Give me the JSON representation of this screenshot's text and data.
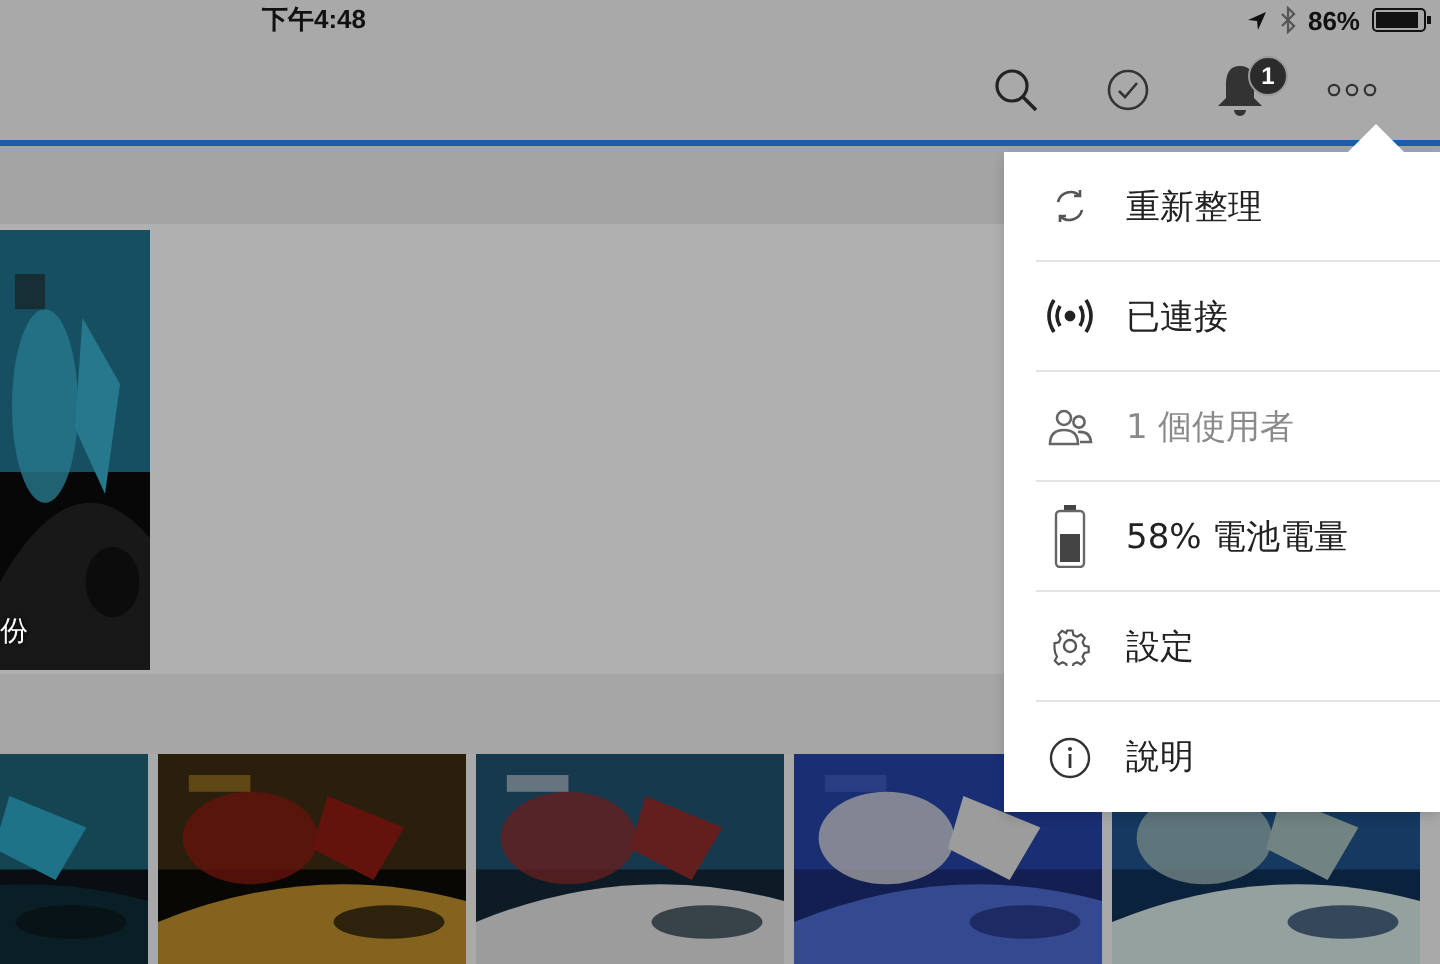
{
  "status_bar": {
    "time": "下午4:48",
    "battery": "86%"
  },
  "toolbar": {
    "notification_badge": "1"
  },
  "featured": {
    "kind": "picture",
    "caption": "份"
  },
  "menu": {
    "items": [
      {
        "kind": "refresh",
        "label": "重新整理",
        "disabled": false
      },
      {
        "kind": "connection",
        "label": "已連接",
        "disabled": false
      },
      {
        "kind": "users",
        "label": "1 個使用者",
        "disabled": true
      },
      {
        "kind": "battery",
        "label": "58% 電池電量",
        "disabled": false
      },
      {
        "kind": "settings",
        "label": "設定",
        "disabled": false
      },
      {
        "kind": "help",
        "label": "說明",
        "disabled": false
      }
    ]
  }
}
